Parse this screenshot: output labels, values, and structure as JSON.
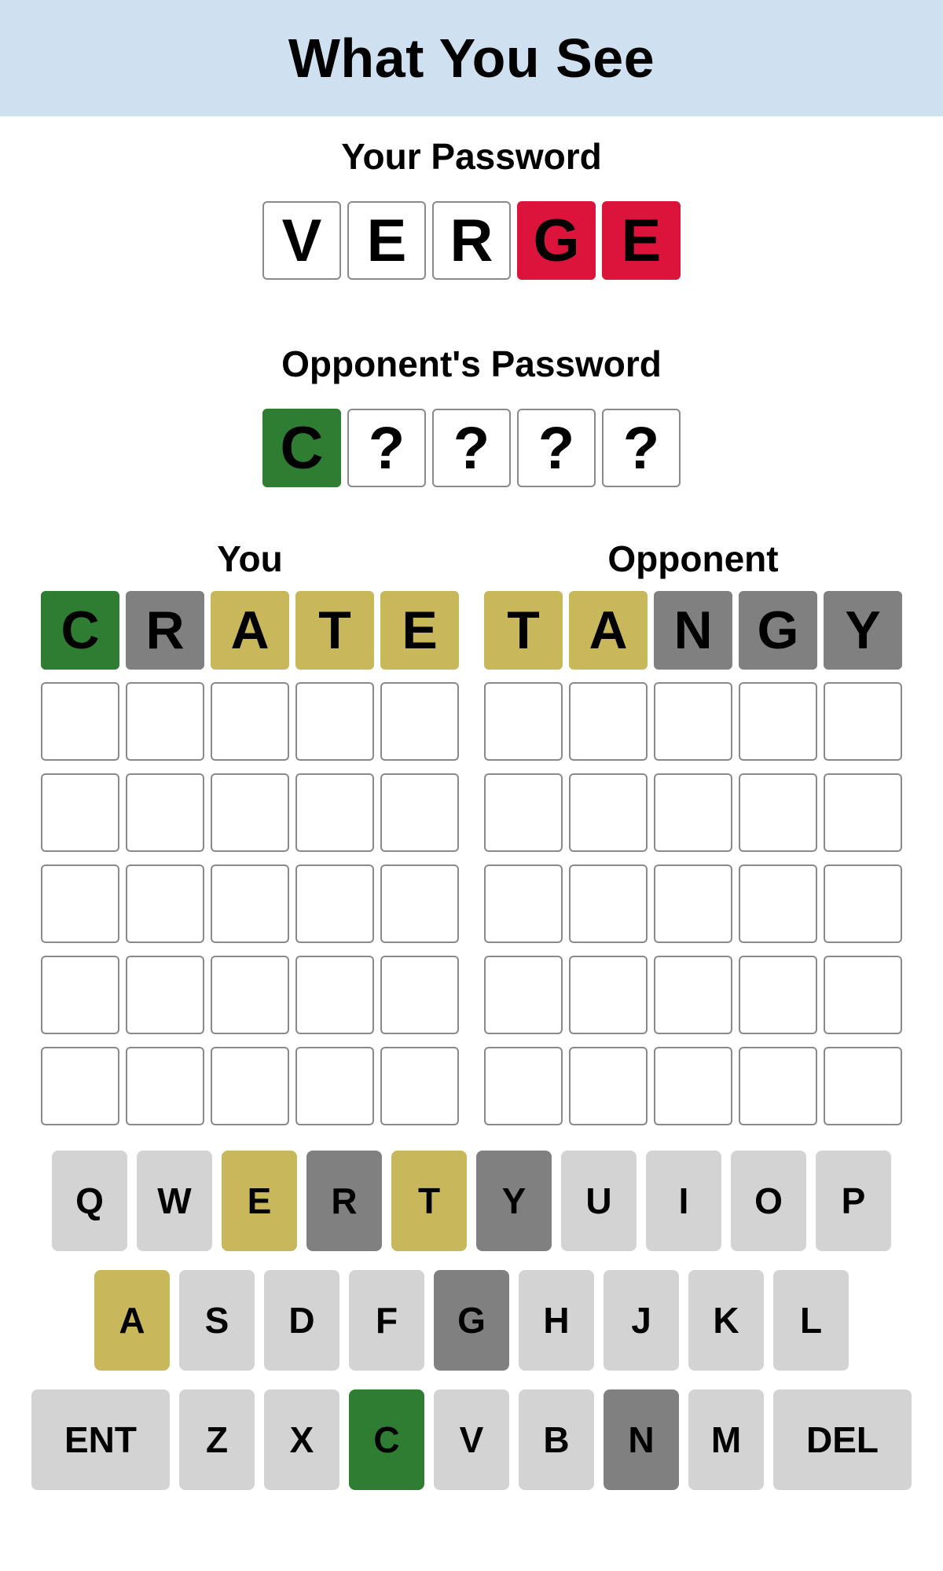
{
  "header": {
    "title": "What You See"
  },
  "your_password": {
    "label": "Your Password",
    "tiles": [
      {
        "letter": "V",
        "state": "empty"
      },
      {
        "letter": "E",
        "state": "empty"
      },
      {
        "letter": "R",
        "state": "empty"
      },
      {
        "letter": "G",
        "state": "revealed"
      },
      {
        "letter": "E",
        "state": "revealed"
      }
    ]
  },
  "opponent_password": {
    "label": "Opponent's Password",
    "tiles": [
      {
        "letter": "C",
        "state": "correct"
      },
      {
        "letter": "?",
        "state": "empty"
      },
      {
        "letter": "?",
        "state": "empty"
      },
      {
        "letter": "?",
        "state": "empty"
      },
      {
        "letter": "?",
        "state": "empty"
      }
    ]
  },
  "boards": [
    {
      "label": "You",
      "rows": [
        [
          {
            "letter": "C",
            "state": "correct"
          },
          {
            "letter": "R",
            "state": "absent"
          },
          {
            "letter": "A",
            "state": "present"
          },
          {
            "letter": "T",
            "state": "present"
          },
          {
            "letter": "E",
            "state": "present"
          }
        ],
        [
          {
            "letter": "",
            "state": "empty"
          },
          {
            "letter": "",
            "state": "empty"
          },
          {
            "letter": "",
            "state": "empty"
          },
          {
            "letter": "",
            "state": "empty"
          },
          {
            "letter": "",
            "state": "empty"
          }
        ],
        [
          {
            "letter": "",
            "state": "empty"
          },
          {
            "letter": "",
            "state": "empty"
          },
          {
            "letter": "",
            "state": "empty"
          },
          {
            "letter": "",
            "state": "empty"
          },
          {
            "letter": "",
            "state": "empty"
          }
        ],
        [
          {
            "letter": "",
            "state": "empty"
          },
          {
            "letter": "",
            "state": "empty"
          },
          {
            "letter": "",
            "state": "empty"
          },
          {
            "letter": "",
            "state": "empty"
          },
          {
            "letter": "",
            "state": "empty"
          }
        ],
        [
          {
            "letter": "",
            "state": "empty"
          },
          {
            "letter": "",
            "state": "empty"
          },
          {
            "letter": "",
            "state": "empty"
          },
          {
            "letter": "",
            "state": "empty"
          },
          {
            "letter": "",
            "state": "empty"
          }
        ],
        [
          {
            "letter": "",
            "state": "empty"
          },
          {
            "letter": "",
            "state": "empty"
          },
          {
            "letter": "",
            "state": "empty"
          },
          {
            "letter": "",
            "state": "empty"
          },
          {
            "letter": "",
            "state": "empty"
          }
        ]
      ]
    },
    {
      "label": "Opponent",
      "rows": [
        [
          {
            "letter": "T",
            "state": "present"
          },
          {
            "letter": "A",
            "state": "present"
          },
          {
            "letter": "N",
            "state": "absent"
          },
          {
            "letter": "G",
            "state": "absent"
          },
          {
            "letter": "Y",
            "state": "absent"
          }
        ],
        [
          {
            "letter": "",
            "state": "empty"
          },
          {
            "letter": "",
            "state": "empty"
          },
          {
            "letter": "",
            "state": "empty"
          },
          {
            "letter": "",
            "state": "empty"
          },
          {
            "letter": "",
            "state": "empty"
          }
        ],
        [
          {
            "letter": "",
            "state": "empty"
          },
          {
            "letter": "",
            "state": "empty"
          },
          {
            "letter": "",
            "state": "empty"
          },
          {
            "letter": "",
            "state": "empty"
          },
          {
            "letter": "",
            "state": "empty"
          }
        ],
        [
          {
            "letter": "",
            "state": "empty"
          },
          {
            "letter": "",
            "state": "empty"
          },
          {
            "letter": "",
            "state": "empty"
          },
          {
            "letter": "",
            "state": "empty"
          },
          {
            "letter": "",
            "state": "empty"
          }
        ],
        [
          {
            "letter": "",
            "state": "empty"
          },
          {
            "letter": "",
            "state": "empty"
          },
          {
            "letter": "",
            "state": "empty"
          },
          {
            "letter": "",
            "state": "empty"
          },
          {
            "letter": "",
            "state": "empty"
          }
        ],
        [
          {
            "letter": "",
            "state": "empty"
          },
          {
            "letter": "",
            "state": "empty"
          },
          {
            "letter": "",
            "state": "empty"
          },
          {
            "letter": "",
            "state": "empty"
          },
          {
            "letter": "",
            "state": "empty"
          }
        ]
      ]
    }
  ],
  "keyboard": {
    "rows": [
      [
        {
          "label": "Q",
          "state": ""
        },
        {
          "label": "W",
          "state": ""
        },
        {
          "label": "E",
          "state": "present"
        },
        {
          "label": "R",
          "state": "absent"
        },
        {
          "label": "T",
          "state": "present"
        },
        {
          "label": "Y",
          "state": "absent"
        },
        {
          "label": "U",
          "state": ""
        },
        {
          "label": "I",
          "state": ""
        },
        {
          "label": "O",
          "state": ""
        },
        {
          "label": "P",
          "state": ""
        }
      ],
      [
        {
          "label": "A",
          "state": "present"
        },
        {
          "label": "S",
          "state": ""
        },
        {
          "label": "D",
          "state": ""
        },
        {
          "label": "F",
          "state": ""
        },
        {
          "label": "G",
          "state": "absent"
        },
        {
          "label": "H",
          "state": ""
        },
        {
          "label": "J",
          "state": ""
        },
        {
          "label": "K",
          "state": ""
        },
        {
          "label": "L",
          "state": ""
        }
      ],
      [
        {
          "label": "ENT",
          "state": ""
        },
        {
          "label": "Z",
          "state": ""
        },
        {
          "label": "X",
          "state": ""
        },
        {
          "label": "C",
          "state": "correct"
        },
        {
          "label": "V",
          "state": ""
        },
        {
          "label": "B",
          "state": ""
        },
        {
          "label": "N",
          "state": "absent"
        },
        {
          "label": "M",
          "state": ""
        },
        {
          "label": "DEL",
          "state": ""
        }
      ]
    ]
  },
  "colors": {
    "header_bg": "#cfe0f1",
    "correct": "#2e7d32",
    "present": "#c9b75c",
    "absent": "#808080",
    "revealed": "#dc143c",
    "key_default": "#d3d3d3"
  }
}
